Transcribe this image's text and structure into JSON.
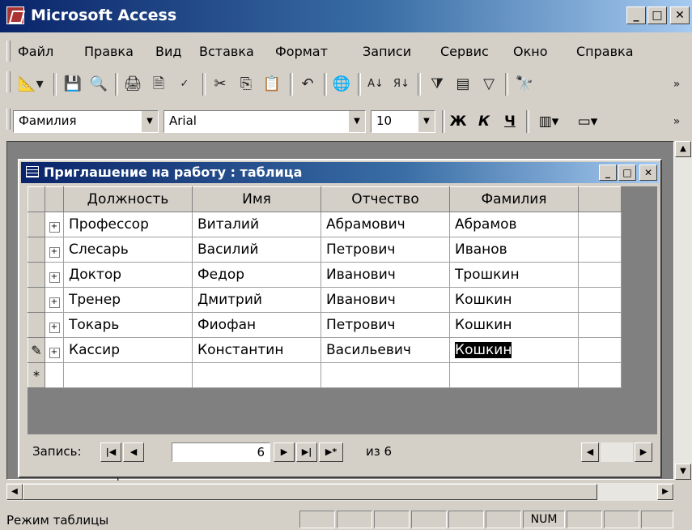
{
  "app": {
    "title": "Microsoft Access"
  },
  "menu": [
    "Файл",
    "Правка",
    "Вид",
    "Вставка",
    "Формат",
    "Записи",
    "Сервис",
    "Окно",
    "Справка"
  ],
  "format": {
    "field": "Фамилия",
    "font": "Arial",
    "size": "10",
    "bold": "Ж",
    "italic": "К",
    "underline": "Ч"
  },
  "table_window": {
    "title": "Приглашение на работу : таблица",
    "columns": [
      "Должность",
      "Имя",
      "Отчество",
      "Фамилия"
    ],
    "rows": [
      [
        "Профессор",
        "Виталий",
        "Абрамович",
        "Абрамов"
      ],
      [
        "Слесарь",
        "Василий",
        "Петрович",
        "Иванов"
      ],
      [
        "Доктор",
        "Федор",
        "Иванович",
        "Трошкин"
      ],
      [
        "Тренер",
        "Дмитрий",
        "Иванович",
        "Кошкин"
      ],
      [
        "Токарь",
        "Фиофан",
        "Петрович",
        "Кошкин"
      ],
      [
        "Кассир",
        "Константин",
        "Васильевич",
        "Кошкин"
      ]
    ],
    "new_row_marker": "*",
    "edit_marker": "✎",
    "nav": {
      "label": "Запись:",
      "current": "6",
      "total": "из 6"
    }
  },
  "partial_text": "Макросы",
  "status": {
    "text": "Режим таблицы",
    "num": "NUM"
  }
}
